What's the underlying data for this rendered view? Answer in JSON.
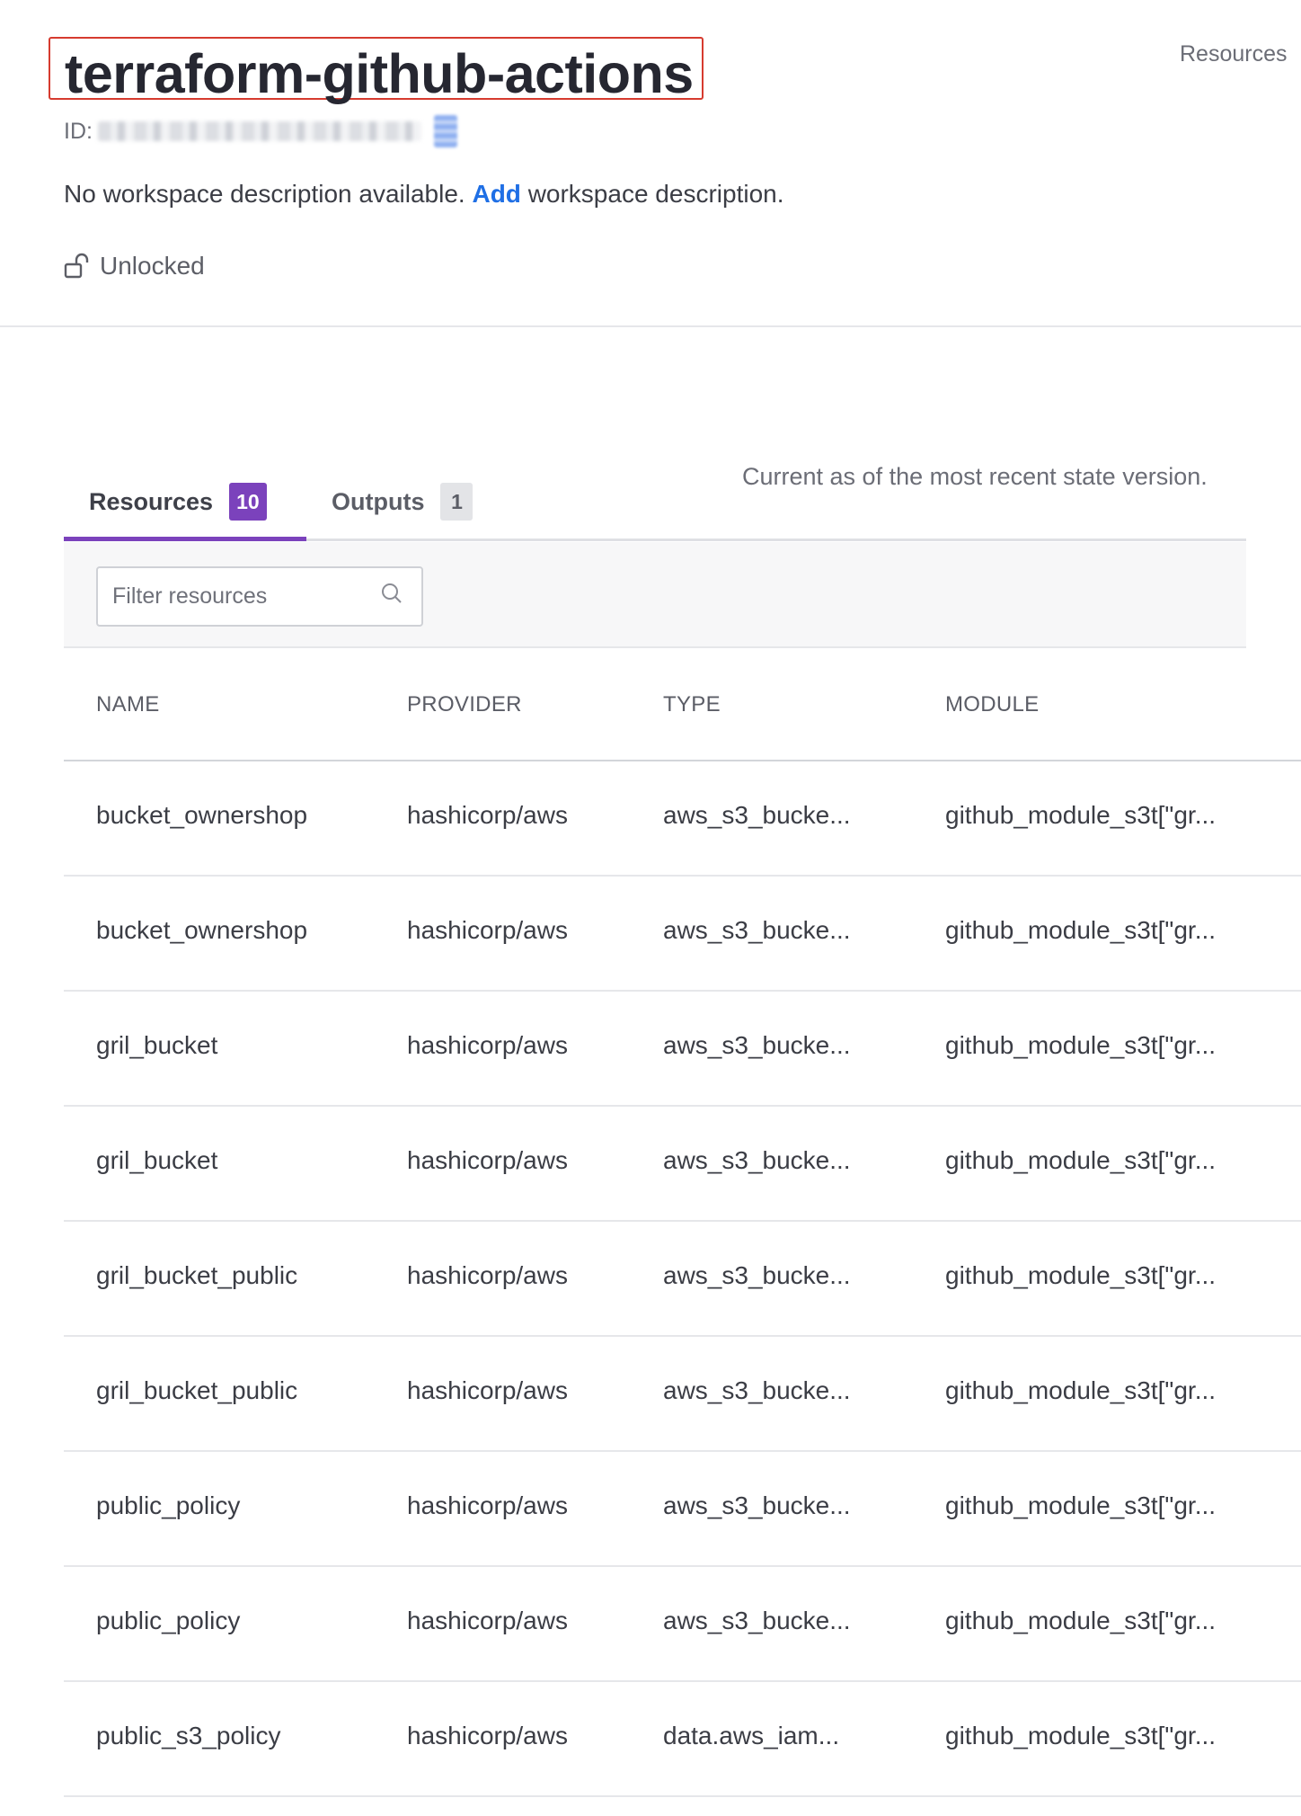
{
  "workspace": {
    "name": "terraform-github-actions",
    "id_label": "ID:",
    "description_prefix": "No workspace description available.",
    "description_link": "Add",
    "description_suffix": "workspace description.",
    "lock_status": "Unlocked"
  },
  "header": {
    "top_link": "Resources"
  },
  "tabs": [
    {
      "label": "Resources",
      "count": "10",
      "active": true
    },
    {
      "label": "Outputs",
      "count": "1",
      "active": false
    }
  ],
  "state_note": "Current as of the most recent state version.",
  "filter": {
    "placeholder": "Filter resources"
  },
  "table": {
    "columns": [
      "NAME",
      "PROVIDER",
      "TYPE",
      "MODULE"
    ],
    "rows": [
      [
        "bucket_ownershop",
        "hashicorp/aws",
        "aws_s3_bucke...",
        "github_module_s3t[\"gr..."
      ],
      [
        "bucket_ownershop",
        "hashicorp/aws",
        "aws_s3_bucke...",
        "github_module_s3t[\"gr..."
      ],
      [
        "gril_bucket",
        "hashicorp/aws",
        "aws_s3_bucke...",
        "github_module_s3t[\"gr..."
      ],
      [
        "gril_bucket",
        "hashicorp/aws",
        "aws_s3_bucke...",
        "github_module_s3t[\"gr..."
      ],
      [
        "gril_bucket_public",
        "hashicorp/aws",
        "aws_s3_bucke...",
        "github_module_s3t[\"gr..."
      ],
      [
        "gril_bucket_public",
        "hashicorp/aws",
        "aws_s3_bucke...",
        "github_module_s3t[\"gr..."
      ],
      [
        "public_policy",
        "hashicorp/aws",
        "aws_s3_bucke...",
        "github_module_s3t[\"gr..."
      ],
      [
        "public_policy",
        "hashicorp/aws",
        "aws_s3_bucke...",
        "github_module_s3t[\"gr..."
      ],
      [
        "public_s3_policy",
        "hashicorp/aws",
        "data.aws_iam...",
        "github_module_s3t[\"gr..."
      ]
    ]
  },
  "colors": {
    "accent": "#7b42bc",
    "link": "#1f6fe5",
    "highlight": "#d63b2f"
  },
  "icons": {
    "lock": "unlocked-padlock-icon",
    "search": "magnifier-icon",
    "copy": "copy-icon"
  }
}
